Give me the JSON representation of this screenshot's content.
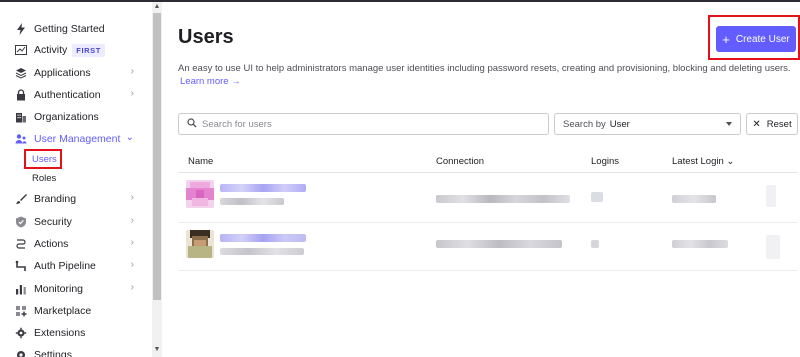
{
  "sidebar": {
    "items": [
      {
        "label": "Getting Started",
        "icon": "bolt-icon",
        "chevron": false
      },
      {
        "label": "Activity",
        "icon": "chart-icon",
        "badge": "FIRST",
        "chevron": false
      },
      {
        "label": "Applications",
        "icon": "layers-icon",
        "chevron": true
      },
      {
        "label": "Authentication",
        "icon": "lock-icon",
        "chevron": true
      },
      {
        "label": "Organizations",
        "icon": "building-icon",
        "chevron": false
      },
      {
        "label": "User Management",
        "icon": "users-icon",
        "chevron": true,
        "active": true
      },
      {
        "label": "Branding",
        "icon": "brush-icon",
        "chevron": true
      },
      {
        "label": "Security",
        "icon": "shield-icon",
        "chevron": true
      },
      {
        "label": "Actions",
        "icon": "actions-icon",
        "chevron": true
      },
      {
        "label": "Auth Pipeline",
        "icon": "pipeline-icon",
        "chevron": true
      },
      {
        "label": "Monitoring",
        "icon": "bar-chart-icon",
        "chevron": true
      },
      {
        "label": "Marketplace",
        "icon": "grid-plus-icon",
        "chevron": false
      },
      {
        "label": "Extensions",
        "icon": "gear-cog-icon",
        "chevron": false
      },
      {
        "label": "Settings",
        "icon": "settings-icon",
        "chevron": false
      }
    ],
    "subitems": [
      {
        "label": "Users",
        "active": true
      },
      {
        "label": "Roles",
        "active": false
      }
    ]
  },
  "main": {
    "title": "Users",
    "create_button": "Create User",
    "description": "An easy to use UI to help administrators manage user identities including password resets, creating and provisioning, blocking and deleting users.",
    "learn_more": "Learn more →",
    "search_placeholder": "Search for users",
    "search_by_label": "Search by",
    "search_by_value": "User",
    "reset_label": "Reset",
    "columns": [
      "Name",
      "Connection",
      "Logins",
      "Latest Login ⌄"
    ]
  },
  "colors": {
    "accent": "#635dff",
    "highlight": "#e4111b"
  }
}
